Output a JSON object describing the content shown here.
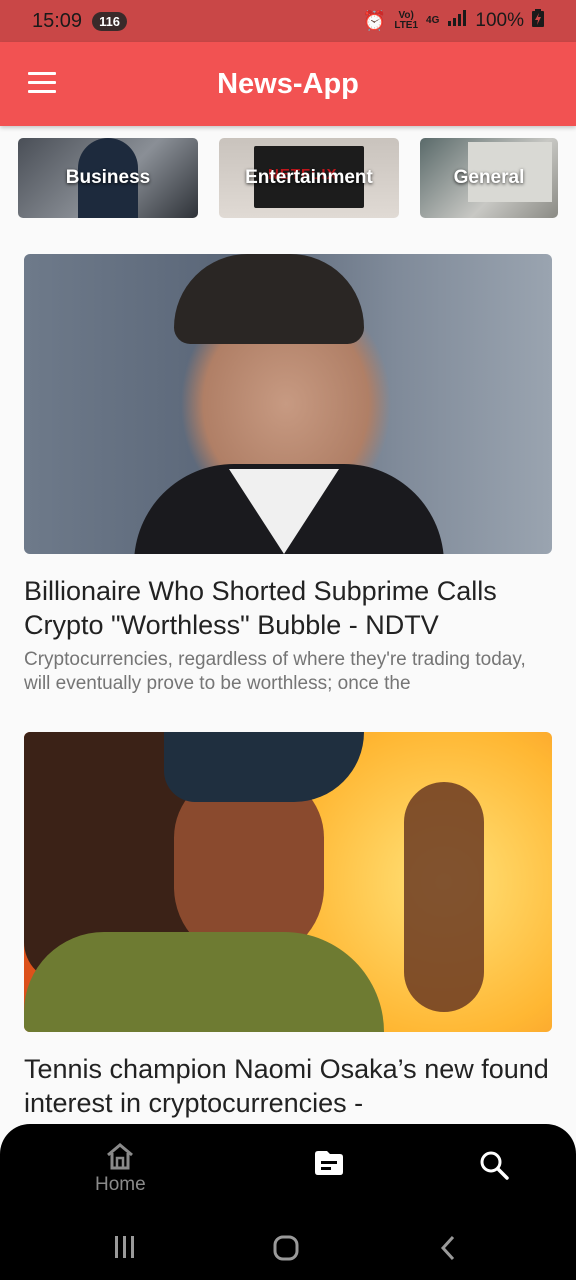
{
  "status_bar": {
    "time": "15:09",
    "notification_count": "116",
    "network_top": "Vo)",
    "network_bottom": "LTE1",
    "net_type": "4G",
    "battery": "100%"
  },
  "app_bar": {
    "title": "News-App"
  },
  "categories": [
    {
      "label": "Business"
    },
    {
      "label": "Entertainment",
      "tv_text": "NETFLIX"
    },
    {
      "label": "General"
    }
  ],
  "articles": [
    {
      "title": "Billionaire Who Shorted Subprime Calls Crypto \"Worthless\" Bubble - NDTV",
      "description": "Cryptocurrencies, regardless of where they're trading today, will eventually prove to be worthless; once the"
    },
    {
      "title": "Tennis champion Naomi Osaka’s new found interest in cryptocurrencies -",
      "description": ""
    }
  ],
  "bottom_nav": {
    "home_label": "Home",
    "active_color": "#ffffff",
    "inactive_color": "#8a8a8a"
  },
  "colors": {
    "app_bar": "#f25252",
    "status_bar": "#c94747"
  }
}
